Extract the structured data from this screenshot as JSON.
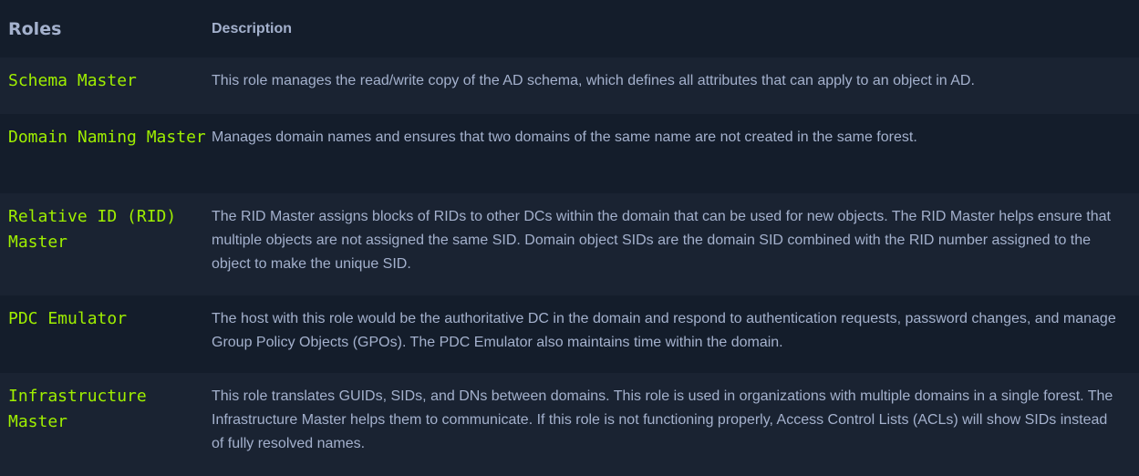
{
  "table": {
    "headers": {
      "roles": "Roles",
      "description": "Description"
    },
    "rows": [
      {
        "role": "Schema Master",
        "description": "This role manages the read/write copy of the AD schema, which defines all attributes that can apply to an object in AD."
      },
      {
        "role": "Domain Naming Master",
        "description": "Manages domain names and ensures that two domains of the same name are not created in the same forest."
      },
      {
        "role": "Relative ID (RID) Master",
        "description": "The RID Master assigns blocks of RIDs to other DCs within the domain that can be used for new objects. The RID Master helps ensure that multiple objects are not assigned the same SID. Domain object SIDs are the domain SID combined with the RID number assigned to the object to make the unique SID."
      },
      {
        "role": "PDC Emulator",
        "description": "The host with this role would be the authoritative DC in the domain and respond to authentication requests, password changes, and manage Group Policy Objects (GPOs). The PDC Emulator also maintains time within the domain."
      },
      {
        "role": "Infrastructure Master",
        "description": "This role translates GUIDs, SIDs, and DNs between domains. This role is used in organizations with multiple domains in a single forest. The Infrastructure Master helps them to communicate. If this role is not functioning properly, Access Control Lists (ACLs) will show SIDs instead of fully resolved names."
      }
    ]
  },
  "colors": {
    "background": "#141d2b",
    "row_alt_background": "#1a2332",
    "role_text": "#9fef00",
    "body_text": "#a4b1cd"
  }
}
